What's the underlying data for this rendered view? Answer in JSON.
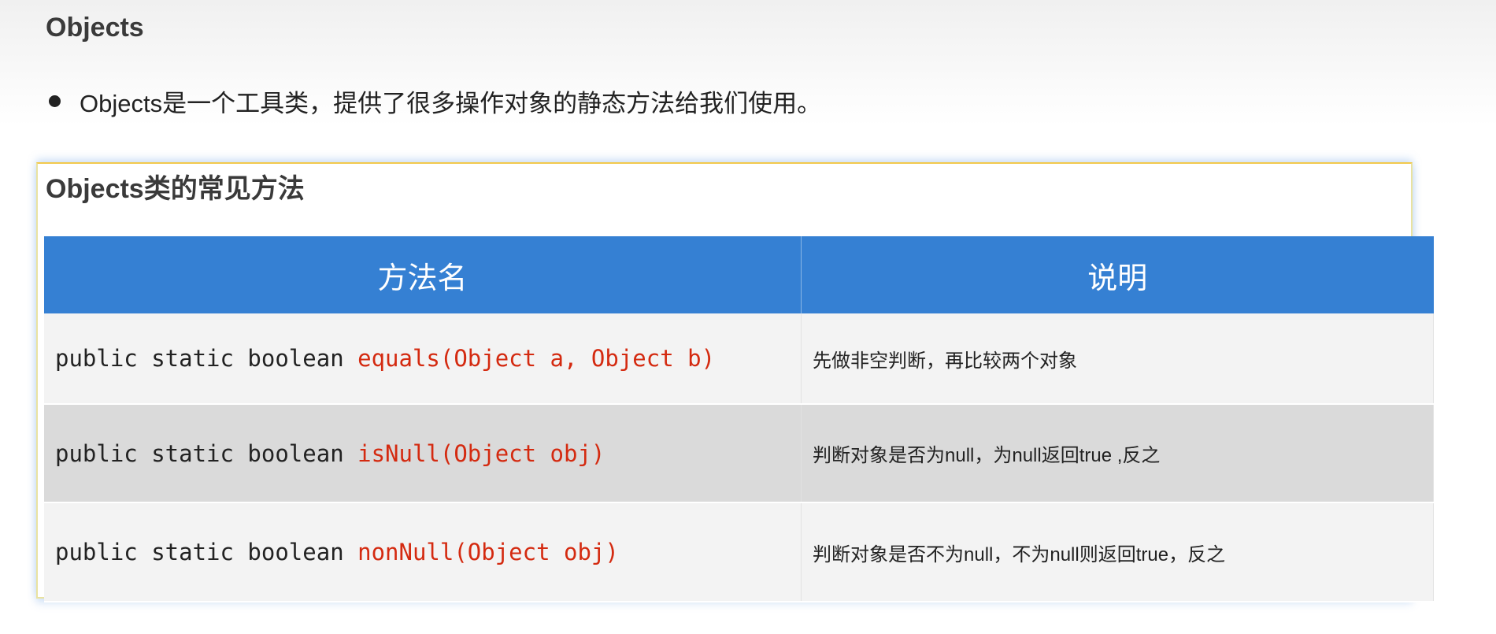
{
  "page": {
    "title": "Objects",
    "bullet": "Objects是一个工具类，提供了很多操作对象的静态方法给我们使用。"
  },
  "card": {
    "subtitle": "Objects类的常见方法",
    "headers": [
      "方法名",
      "说明"
    ],
    "rows": [
      {
        "prefix": "public static boolean ",
        "method": "equals(Object a, Object b)",
        "desc": "先做非空判断，再比较两个对象"
      },
      {
        "prefix": "public static boolean ",
        "method": "isNull(Object obj)",
        "desc": "判断对象是否为null，为null返回true ,反之"
      },
      {
        "prefix": "public static boolean ",
        "method": "nonNull(Object obj)",
        "desc": "判断对象是否不为null，不为null则返回true，反之"
      }
    ]
  },
  "colors": {
    "header": "#3580d3",
    "method": "#d42a10"
  }
}
